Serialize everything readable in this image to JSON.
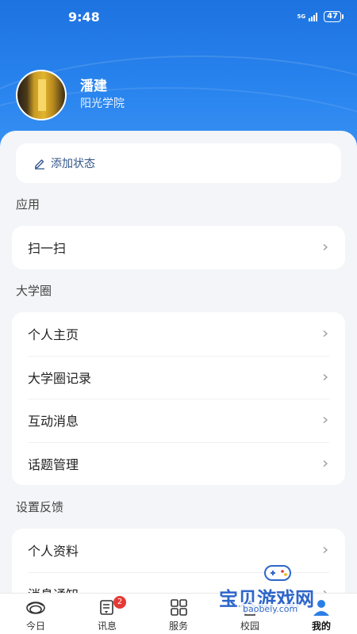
{
  "status_bar": {
    "time": "9:48",
    "network": "5G",
    "battery": "47"
  },
  "profile": {
    "name": "潘建",
    "school": "阳光学院"
  },
  "status_card": {
    "label": "添加状态"
  },
  "sections": [
    {
      "title": "应用",
      "items": [
        "扫一扫"
      ]
    },
    {
      "title": "大学圈",
      "items": [
        "个人主页",
        "大学圈记录",
        "互动消息",
        "话题管理"
      ]
    },
    {
      "title": "设置反馈",
      "items": [
        "个人资料",
        "消息通知"
      ]
    }
  ],
  "nav": {
    "items": [
      {
        "label": "今日",
        "icon": "today-logo-icon"
      },
      {
        "label": "讯息",
        "icon": "message-icon",
        "badge": "2"
      },
      {
        "label": "服务",
        "icon": "grid-icon"
      },
      {
        "label": "校园",
        "icon": "campus-icon"
      },
      {
        "label": "我的",
        "icon": "profile-icon",
        "active": true
      }
    ]
  },
  "watermark": {
    "text": "宝贝游戏网",
    "url": "baobeiy.com"
  },
  "colors": {
    "primary": "#1d73e0",
    "badge": "#e53935",
    "link": "#33568a"
  }
}
